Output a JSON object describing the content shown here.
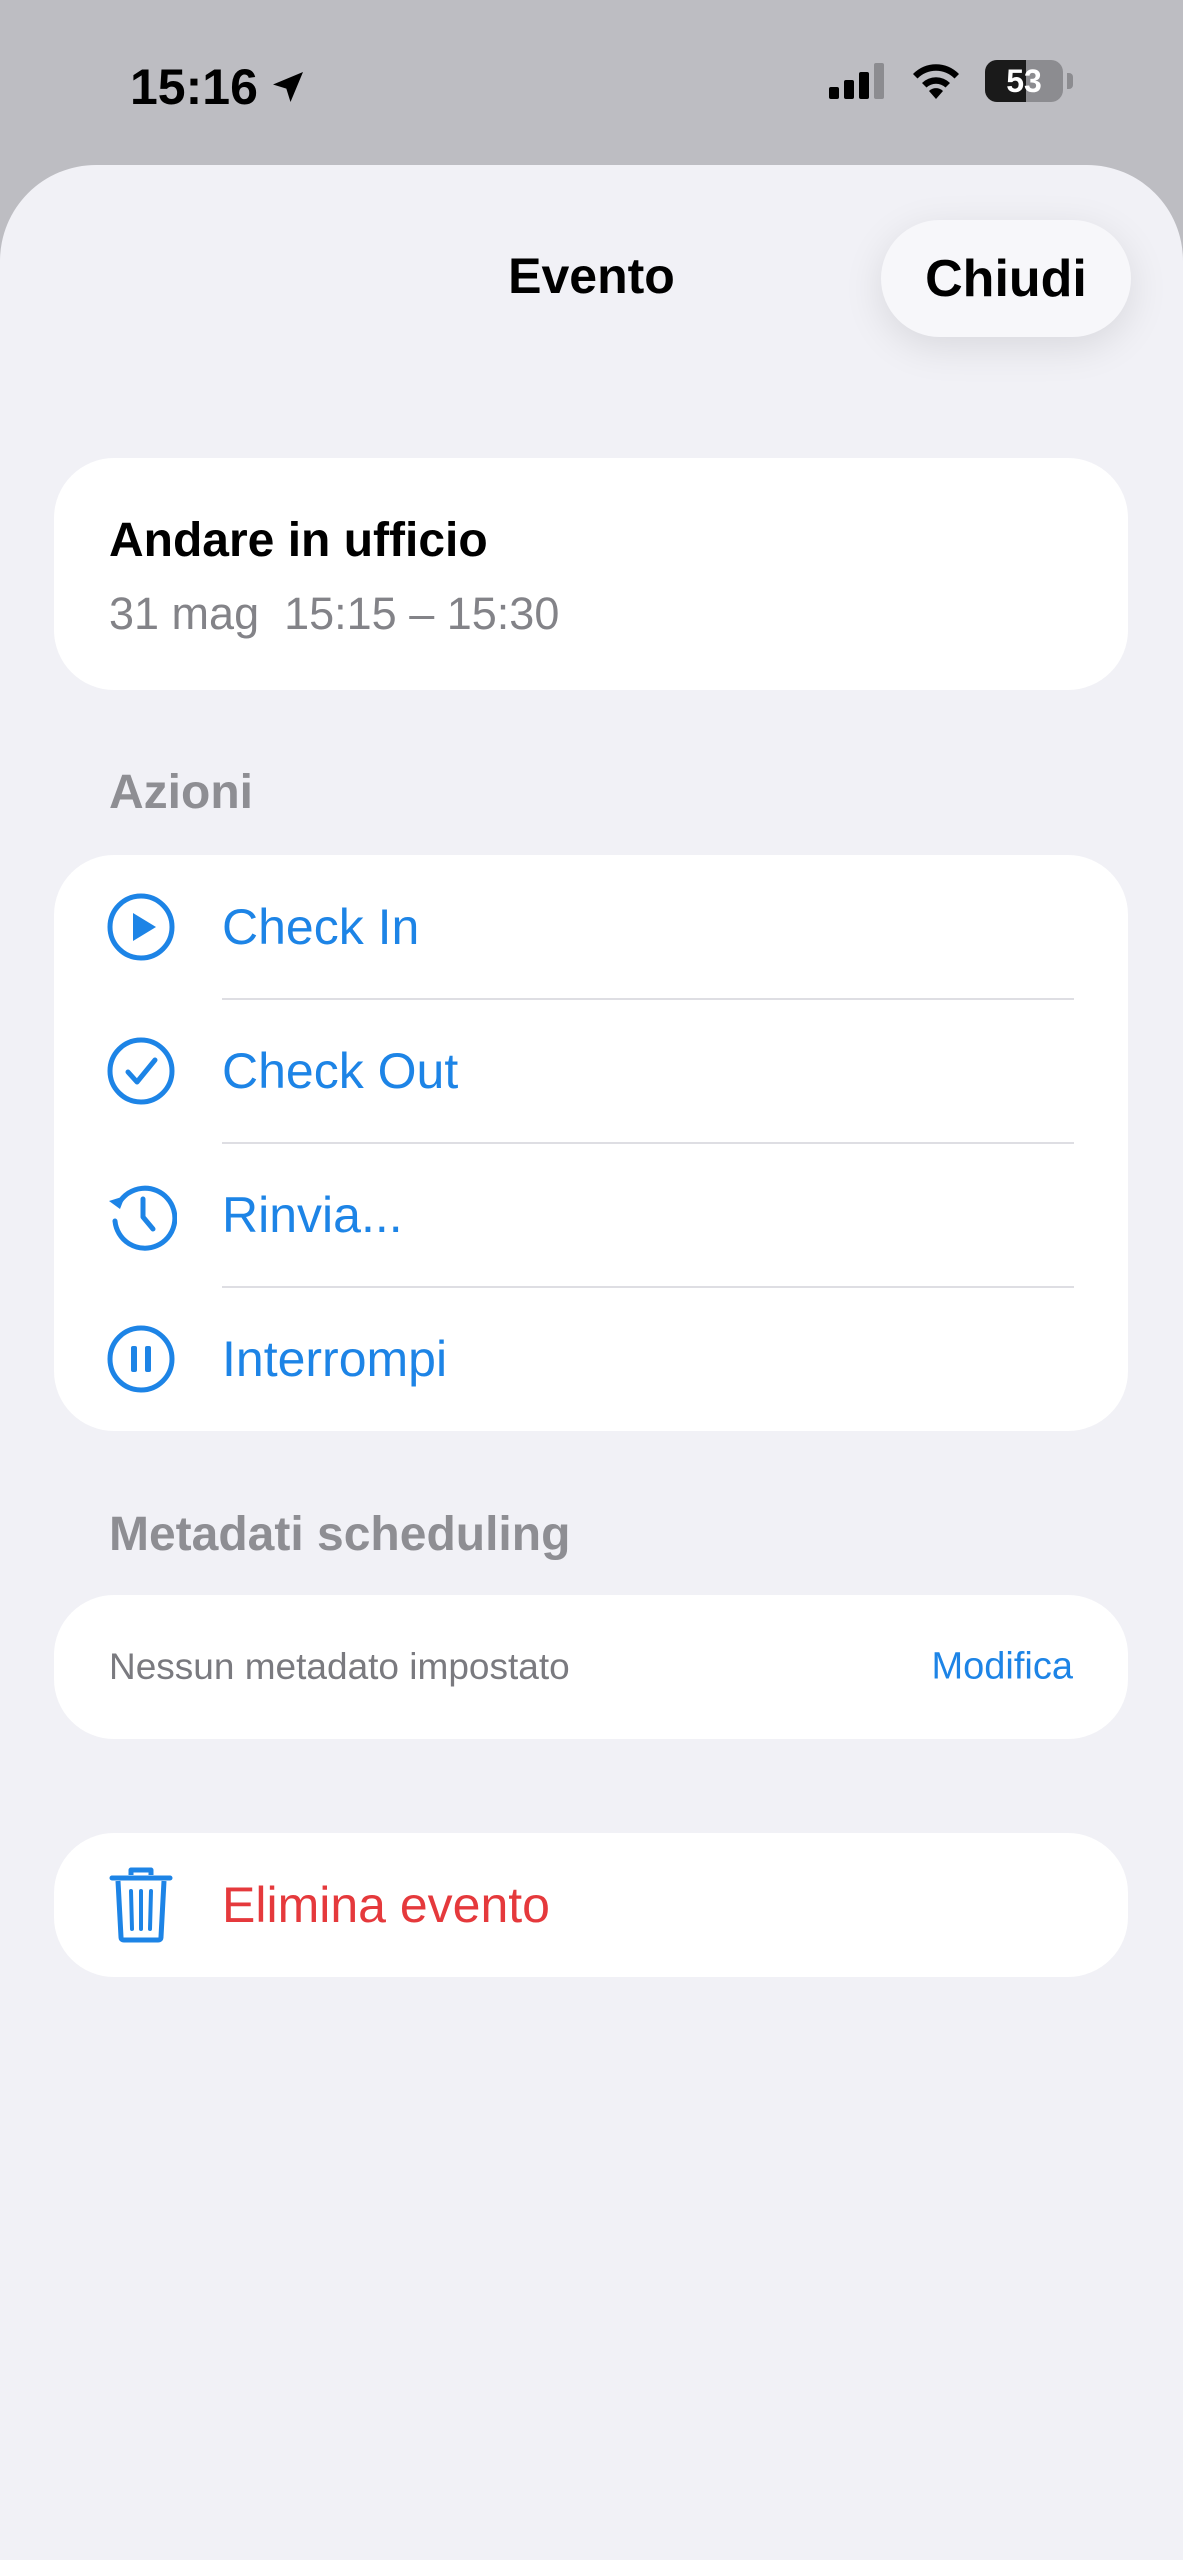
{
  "status_bar": {
    "time": "15:16",
    "battery_level": "53",
    "icons": [
      "location-arrow-icon",
      "signal-icon",
      "wifi-icon",
      "battery-icon"
    ]
  },
  "sheet": {
    "title": "Evento",
    "close_label": "Chiudi"
  },
  "event": {
    "title": "Andare in ufficio",
    "time": "31 mag  15:15 – 15:30"
  },
  "actions": {
    "header": "Azioni",
    "items": [
      {
        "label": "Check In",
        "icon": "play-circle-icon"
      },
      {
        "label": "Check Out",
        "icon": "checkmark-circle-icon"
      },
      {
        "label": "Rinvia...",
        "icon": "clock-history-icon"
      },
      {
        "label": "Interrompi",
        "icon": "pause-circle-icon"
      }
    ]
  },
  "metadata": {
    "header": "Metadati scheduling",
    "empty_text": "Nessun metadato impostato",
    "edit_label": "Modifica"
  },
  "delete": {
    "label": "Elimina evento",
    "icon": "trash-icon"
  },
  "colors": {
    "accent": "#1d84e6",
    "destructive": "#e5393c",
    "background": "#f1f1f6",
    "secondary_text": "#8e8e93"
  }
}
